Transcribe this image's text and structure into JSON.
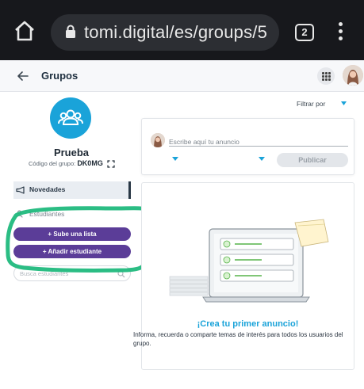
{
  "browser": {
    "url": "tomi.digital/es/groups/5",
    "tab_count": "2",
    "icons": [
      "home-icon",
      "lock-icon",
      "tabs-icon",
      "overflow-menu-icon"
    ]
  },
  "header": {
    "title": "Grupos",
    "icons": [
      "back-arrow-icon",
      "apps-grid-icon",
      "avatar"
    ]
  },
  "group": {
    "name": "Prueba",
    "code_label": "Código del grupo:",
    "code": "DK0MG"
  },
  "nav": {
    "news_label": "Novedades",
    "students_label": "Estudiantes"
  },
  "actions": {
    "upload_list": "+ Sube una lista",
    "add_student": "+ Añadir estudiante"
  },
  "student_search": {
    "placeholder": "Busca estudiantes"
  },
  "filter": {
    "label": "Filtrar por"
  },
  "composer": {
    "placeholder": "Escribe aquí tu anuncio",
    "publish_label": "Publicar"
  },
  "empty_state": {
    "headline": "¡Crea tu primer anuncio!",
    "description": "Informa, recuerda o comparte temas de interés para todos los usuarios del grupo."
  },
  "colors": {
    "accent": "#1aa3d9",
    "button_purple": "#5b3d98",
    "annotation_green": "#19b77a",
    "browser_bar": "#17181c"
  }
}
